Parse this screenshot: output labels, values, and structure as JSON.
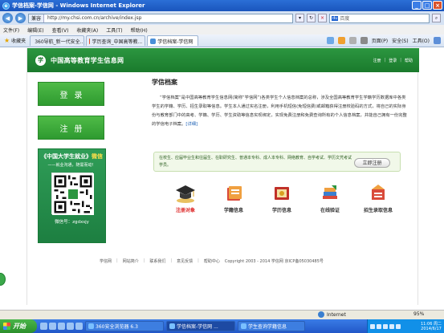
{
  "window": {
    "title": "学信档案-学信网 - Windows Internet Explorer"
  },
  "address_bar": {
    "mode": "兼容",
    "url": "http://my.chsi.com.cn/archive/index.jsp",
    "search_provider": "百度"
  },
  "menu": [
    "文件(F)",
    "编辑(E)",
    "查看(V)",
    "收藏夹(A)",
    "工具(T)",
    "帮助(H)"
  ],
  "favorites": {
    "label": "收藏夹",
    "tabs": [
      {
        "label": "360导航_新一代安全..."
      },
      {
        "label": "学历查询_中国高等教..."
      },
      {
        "label": "学信档案-学信网",
        "active": true
      }
    ],
    "tools": [
      "页面(P)",
      "安全(S)",
      "工具(O)"
    ]
  },
  "site": {
    "title": "中国高等教育学生信息网",
    "header_links": [
      "注册",
      "登录",
      "帮助"
    ]
  },
  "left": {
    "login_label": "登录",
    "register_label": "注册",
    "promo_title": "《中国大学生就业》",
    "promo_title_wx": "微信",
    "promo_sub": "——就业沟通，随需而动！",
    "promo_wechat": "微信号：zgdxsjy"
  },
  "archive": {
    "title": "学信档案",
    "intro": "“学信档案”是中国高等教育学生信息网(简称“学信网”)各类学生个人信息档案的总称，涉及全国高等教育学生学籍学历数据库中各类学生的学籍、学历、招生录取等信息。学生本人通过实名注册，利用手机短信(免短信费)或邮箱获得注册校验码的方式，将自己的实际身份与教育部门中的高考、学籍、学历、学生资助等信息实现绑定，实现免费注册和免费查询所有的个人信息档案，并能自己拥有一份完整的学信电子档案。",
    "more": "[详细]"
  },
  "notice": {
    "text": "在校生、应届毕业生和往届生、在职研究生、普通本专科、成人本专科、网络教育、自学考试、学历文凭考试学员。",
    "button": "立即注册"
  },
  "features": [
    {
      "label": "注册对象",
      "icon": "graduate-cap-icon",
      "highlight": true
    },
    {
      "label": "学籍信息",
      "icon": "student-status-icon",
      "highlight": false
    },
    {
      "label": "学历信息",
      "icon": "diploma-icon",
      "highlight": false
    },
    {
      "label": "在线验证",
      "icon": "verify-books-icon",
      "highlight": false
    },
    {
      "label": "招生录取信息",
      "icon": "admission-letter-icon",
      "highlight": false
    }
  ],
  "footer": {
    "links": [
      "学信网",
      "网站简介",
      "联系我们",
      "意见反馈",
      "帮助中心"
    ],
    "copyright": "Copyright 2003 - 2014 学信网 京ICP备05030485号"
  },
  "status": {
    "zone": "Internet",
    "zoom": "95%"
  },
  "taskbar": {
    "start": "开始",
    "tasks": [
      {
        "label": "360安全浏览器 6.3"
      },
      {
        "label": "学信档案-学信网 ...",
        "active": true
      },
      {
        "label": "学生查询学籍信息"
      }
    ],
    "clock_time": "11:06 周二",
    "clock_date": "2014/6/17"
  },
  "colors": {
    "brand_green": "#2c9640",
    "highlight_red": "#d22222",
    "link_blue": "#1a5fb4"
  }
}
